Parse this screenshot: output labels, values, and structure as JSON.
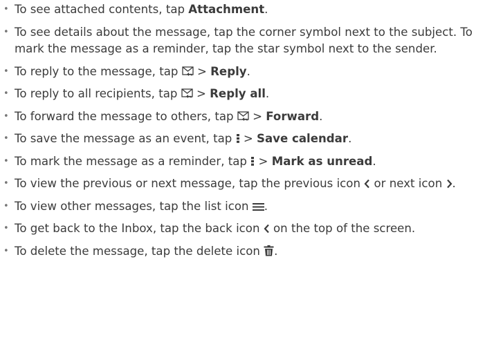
{
  "items": [
    {
      "pre": "To see attached contents, tap ",
      "bold": "Attachment",
      "post": "."
    },
    {
      "text": "To see details about the message, tap the corner symbol next to the subject. To mark the message as a reminder, tap the star symbol next to the sender."
    },
    {
      "pre": "To reply to the message, tap ",
      "mid": " > ",
      "bold": "Reply",
      "post": ".",
      "icon": "reply-menu-icon"
    },
    {
      "pre": "To reply to all recipients, tap ",
      "mid": " > ",
      "bold": "Reply all",
      "post": ".",
      "icon": "reply-menu-icon"
    },
    {
      "pre": "To forward the message to others, tap ",
      "mid": " > ",
      "bold": "Forward",
      "post": ".",
      "icon": "reply-menu-icon"
    },
    {
      "pre": "To save the message as an event, tap ",
      "mid": " > ",
      "bold": "Save calendar",
      "post": ".",
      "icon": "more-options-icon"
    },
    {
      "pre": "To mark the message as a reminder, tap ",
      "mid": " > ",
      "bold": "Mark as unread",
      "post": ".",
      "icon": "more-options-icon"
    },
    {
      "pre": "To view the previous or next message, tap the previous icon ",
      "mid": " or next icon ",
      "post": ".",
      "icon": "chevron-left-icon",
      "icon2": "chevron-right-icon"
    },
    {
      "pre": "To view other messages, tap the list icon ",
      "post": ".",
      "icon": "list-icon"
    },
    {
      "pre": "To get back to the Inbox, tap the back icon ",
      "post": " on the top of the screen.",
      "icon": "back-icon"
    },
    {
      "pre": "To delete the message, tap the delete icon ",
      "post": ".",
      "icon": "delete-icon"
    }
  ],
  "bullet_char": "•"
}
